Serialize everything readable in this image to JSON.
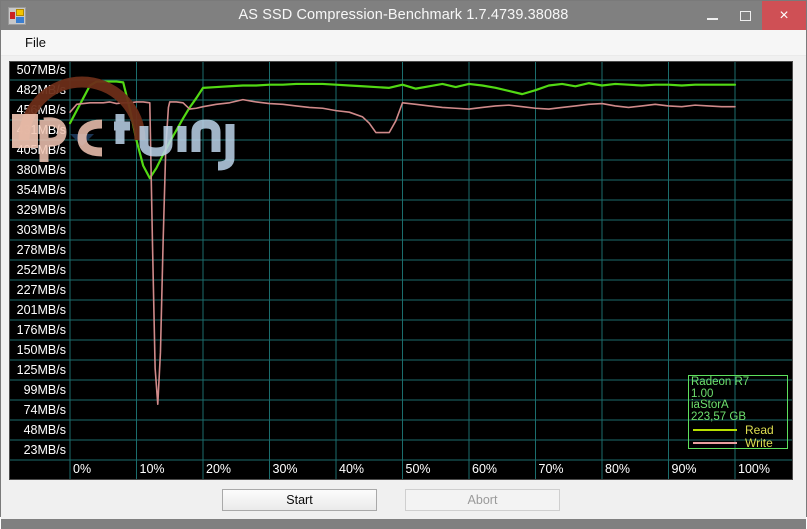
{
  "window": {
    "title": "AS SSD Compression-Benchmark 1.7.4739.38088",
    "icon": "app-grid-icon",
    "minimize_label": "–",
    "maximize_label": "□",
    "close_label": "×"
  },
  "menu": {
    "items": [
      {
        "label": "File"
      }
    ]
  },
  "buttons": {
    "start_label": "Start",
    "abort_label": "Abort"
  },
  "legend": {
    "device": "Radeon R7",
    "firmware": "1.00",
    "driver": "iaStorA",
    "capacity": "223,57 GB",
    "read_label": "Read",
    "write_label": "Write",
    "read_color": "#b8e000",
    "write_color": "#e8a0a0"
  },
  "watermark": {
    "text": "pctuning"
  },
  "chart_data": {
    "type": "line",
    "title": "AS SSD Compression-Benchmark",
    "xlabel": "",
    "ylabel": "MB/s",
    "grid": true,
    "legend_position": "bottom-right",
    "background": "#000000",
    "gridline_color": "#1b6d6d",
    "xlim": [
      0,
      100
    ],
    "ylim": [
      0,
      520
    ],
    "xticks": [
      "0%",
      "10%",
      "20%",
      "30%",
      "40%",
      "50%",
      "60%",
      "70%",
      "80%",
      "90%",
      "100%"
    ],
    "xtick_values": [
      0,
      10,
      20,
      30,
      40,
      50,
      60,
      70,
      80,
      90,
      100
    ],
    "yticks": [
      "507MB/s",
      "482MB/s",
      "456MB/s",
      "431MB/s",
      "405MB/s",
      "380MB/s",
      "354MB/s",
      "329MB/s",
      "303MB/s",
      "278MB/s",
      "252MB/s",
      "227MB/s",
      "201MB/s",
      "176MB/s",
      "150MB/s",
      "125MB/s",
      "99MB/s",
      "74MB/s",
      "48MB/s",
      "23MB/s"
    ],
    "ytick_values": [
      507,
      482,
      456,
      431,
      405,
      380,
      354,
      329,
      303,
      278,
      252,
      227,
      201,
      176,
      150,
      125,
      99,
      74,
      48,
      23
    ],
    "series": [
      {
        "name": "Read",
        "color": "#52d914",
        "x": [
          0,
          1,
          2,
          3,
          4,
          5,
          6,
          7,
          8,
          9,
          10,
          11,
          12,
          13,
          14,
          15,
          16,
          17,
          18,
          19,
          20,
          22,
          24,
          26,
          28,
          30,
          32,
          34,
          36,
          38,
          40,
          42,
          44,
          46,
          48,
          50,
          52,
          54,
          56,
          58,
          60,
          62,
          64,
          66,
          68,
          70,
          72,
          74,
          76,
          78,
          80,
          82,
          84,
          86,
          88,
          90,
          92,
          94,
          96,
          98,
          100
        ],
        "y": [
          452,
          468,
          484,
          500,
          505,
          505,
          505,
          505,
          504,
          470,
          430,
          398,
          382,
          395,
          412,
          428,
          443,
          458,
          472,
          484,
          497,
          498,
          499,
          500,
          500,
          501,
          501,
          502,
          502,
          502,
          501,
          500,
          499,
          498,
          497,
          501,
          496,
          499,
          502,
          498,
          502,
          500,
          497,
          493,
          489,
          494,
          500,
          502,
          499,
          503,
          500,
          502,
          501,
          500,
          501,
          501,
          500,
          501,
          501,
          501,
          501
        ]
      },
      {
        "name": "Write",
        "color": "#d08a8a",
        "x": [
          0,
          1,
          2,
          3,
          4,
          5,
          6,
          7,
          8,
          9,
          10,
          11,
          12,
          12.4,
          12.8,
          13.2,
          13.6,
          14,
          14.4,
          14.8,
          15,
          16,
          17,
          18,
          19,
          20,
          22,
          24,
          26,
          28,
          30,
          32,
          34,
          36,
          38,
          40,
          42,
          44,
          45,
          46,
          47,
          48,
          49,
          50,
          52,
          54,
          56,
          58,
          60,
          62,
          64,
          66,
          68,
          70,
          72,
          74,
          76,
          78,
          80,
          82,
          84,
          86,
          88,
          90,
          92,
          94,
          96,
          98,
          100
        ],
        "y": [
          466,
          476,
          477,
          478,
          478,
          478,
          479,
          477,
          478,
          478,
          479,
          479,
          478,
          300,
          140,
          94,
          160,
          300,
          420,
          472,
          479,
          479,
          478,
          470,
          471,
          473,
          476,
          478,
          482,
          479,
          477,
          476,
          474,
          472,
          471,
          468,
          466,
          460,
          452,
          440,
          440,
          440,
          455,
          478,
          476,
          474,
          472,
          471,
          470,
          472,
          474,
          475,
          473,
          471,
          470,
          472,
          474,
          476,
          477,
          474,
          472,
          474,
          476,
          474,
          473,
          475,
          474,
          473,
          473
        ]
      }
    ]
  }
}
